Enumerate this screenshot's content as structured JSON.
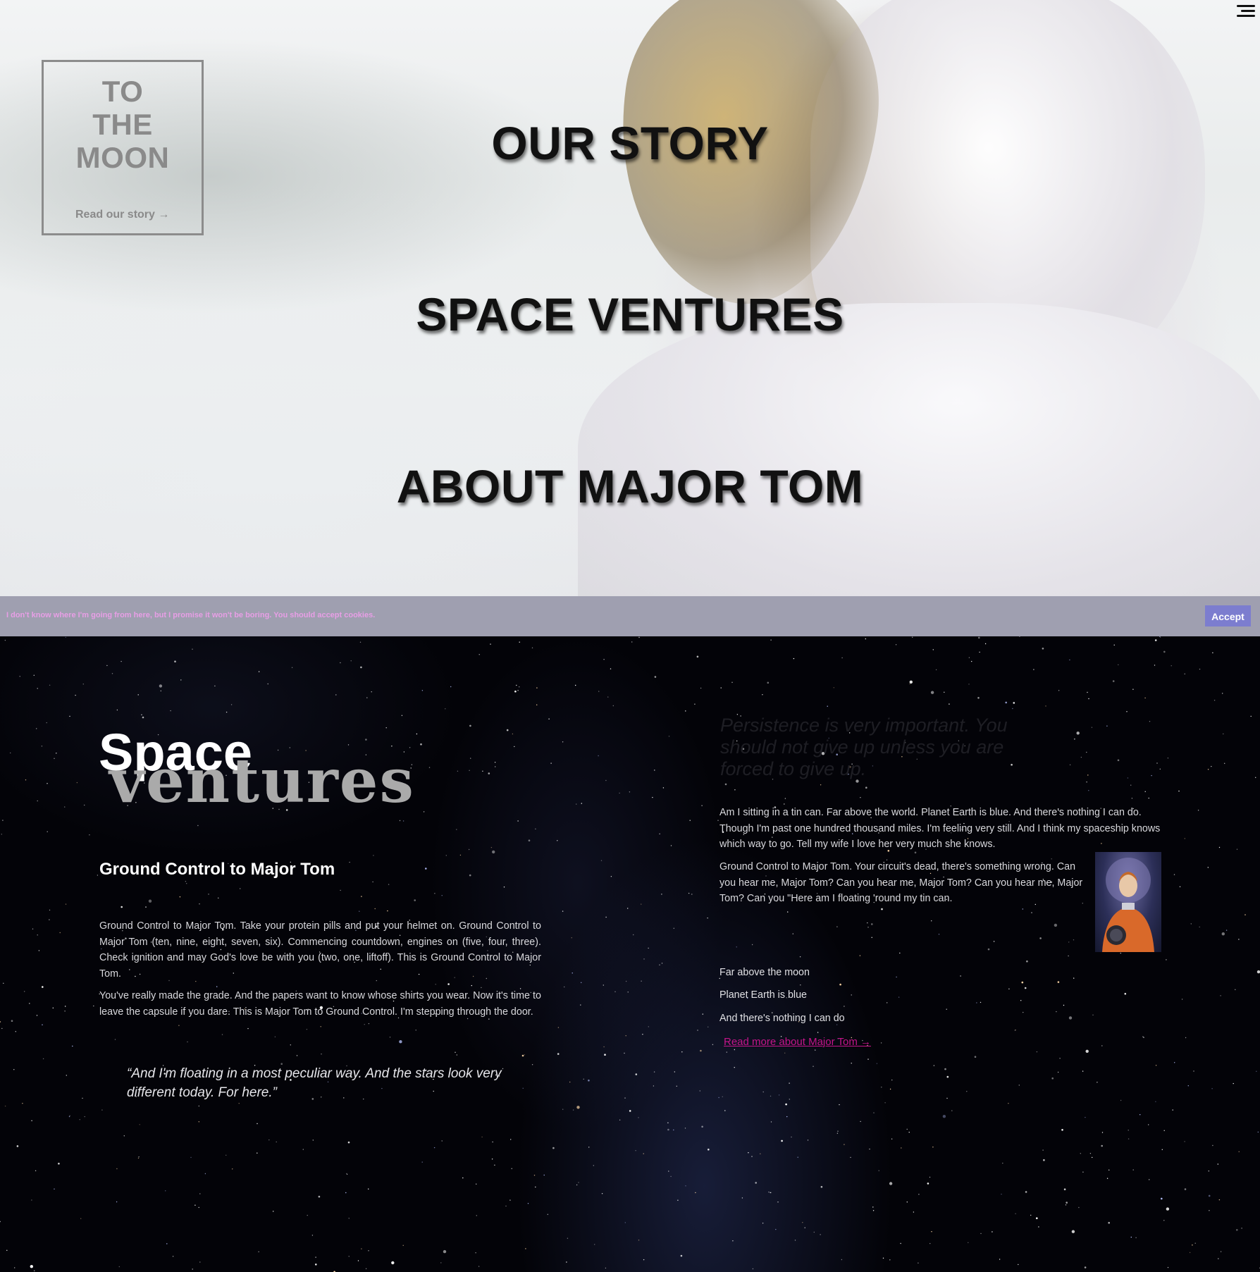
{
  "hero": {
    "logo": {
      "title": "TO\nTHE\nMOON",
      "link": "Read our story →"
    },
    "menu_icon": "hamburger-menu-icon",
    "nav": [
      {
        "label": "OUR STORY"
      },
      {
        "label": "SPACE VENTURES"
      },
      {
        "label": "ABOUT MAJOR TOM"
      }
    ]
  },
  "cookie_bar": {
    "text": "I don't know where I'm going from here, but I promise it won't be boring. You should accept cookies.",
    "accept_label": "Accept"
  },
  "space_section": {
    "title_space": "Space",
    "title_ventures": "ventures",
    "heading": "Ground Control to Major Tom",
    "paragraphs": [
      "Ground Control to Major Tom. Take your protein pills and put your helmet on. Ground Control to Major Tom (ten, nine, eight, seven, six). Commencing countdown, engines on (five, four, three). Check ignition and may God's love be with you (two, one, liftoff). This is Ground Control to Major Tom.",
      "You've really made the grade. And the papers want to know whose shirts you wear. Now it's time to leave the capsule if you dare. This is Major Tom to Ground Control. I'm stepping through the door."
    ],
    "quote": "“And I'm floating in a most peculiar way. And the stars look very different today. For here.”",
    "side_quote": "Persistence is very important. You should not give up unless you are forced to give up.",
    "side_paragraphs": [
      "Am I sitting in a tin can. Far above the world. Planet Earth is blue. And there's nothing I can do. Though I'm past one hundred thousand miles. I'm feeling very still. And I think my spaceship knows which way to go. Tell my wife I love her very much she knows.",
      "Ground Control to Major Tom. Your circuit's dead, there's something wrong. Can you hear me, Major Tom? Can you hear me, Major Tom? Can you hear me, Major Tom? Can you \"Here am I floating 'round my tin can."
    ],
    "lyrics": [
      "Far above the moon",
      "Planet Earth is blue",
      "And there's nothing I can do"
    ],
    "read_more": "Read more about Major Tom →"
  },
  "colors": {
    "cookie_bar_bg": "#9f9fb0",
    "cookie_text": "#e89ee6",
    "accept_button": "#7c7dcf",
    "read_more_link": "#c4148a"
  }
}
